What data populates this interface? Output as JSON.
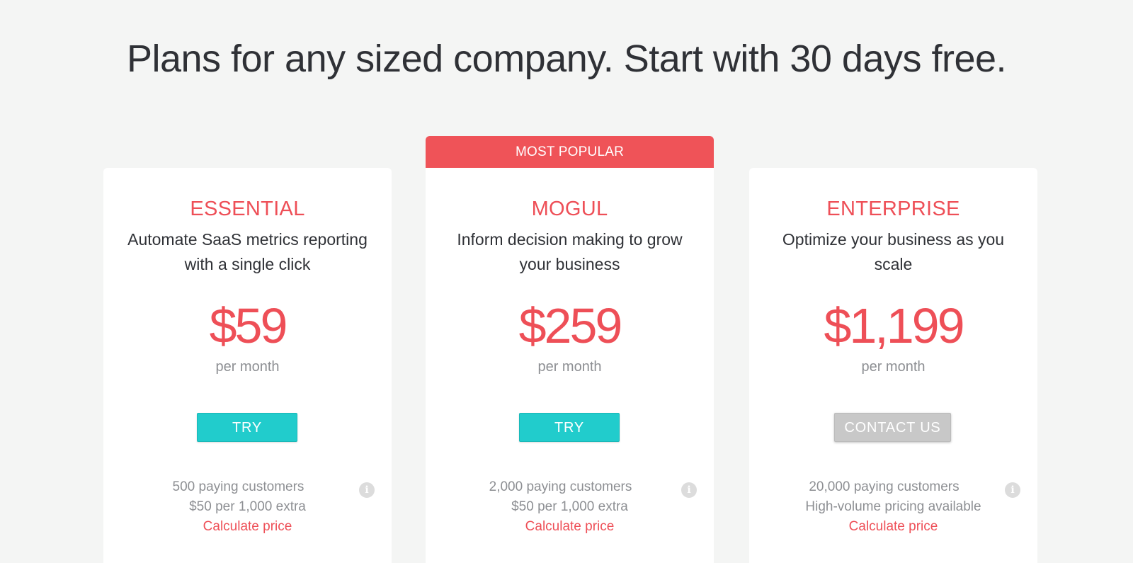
{
  "headline": "Plans for any sized company. Start with 30 days free.",
  "ribbon": "MOST POPULAR",
  "colors": {
    "accent": "#ee4f57",
    "ribbon": "#ef5358",
    "try_button": "#21cccc",
    "contact_button": "#c8c8c8",
    "background": "#f4f5f4",
    "muted_text": "#8d8f93"
  },
  "icons": {
    "info": "info-circle-icon"
  },
  "plans": [
    {
      "name": "ESSENTIAL",
      "description": "Automate SaaS metrics reporting with a single click",
      "price": "$59",
      "period": "per month",
      "button": "TRY",
      "feature_1": "500 paying customers",
      "feature_2": "$50 per 1,000 extra",
      "link": "Calculate price"
    },
    {
      "name": "MOGUL",
      "description": "Inform decision making to grow your business",
      "price": "$259",
      "period": "per month",
      "button": "TRY",
      "feature_1": "2,000 paying customers",
      "feature_2": "$50 per 1,000 extra",
      "link": "Calculate price"
    },
    {
      "name": "ENTERPRISE",
      "description": "Optimize your business as you scale",
      "price": "$1,199",
      "period": "per month",
      "button": "CONTACT US",
      "feature_1": "20,000 paying customers",
      "feature_2": "High-volume pricing available",
      "link": "Calculate price"
    }
  ]
}
